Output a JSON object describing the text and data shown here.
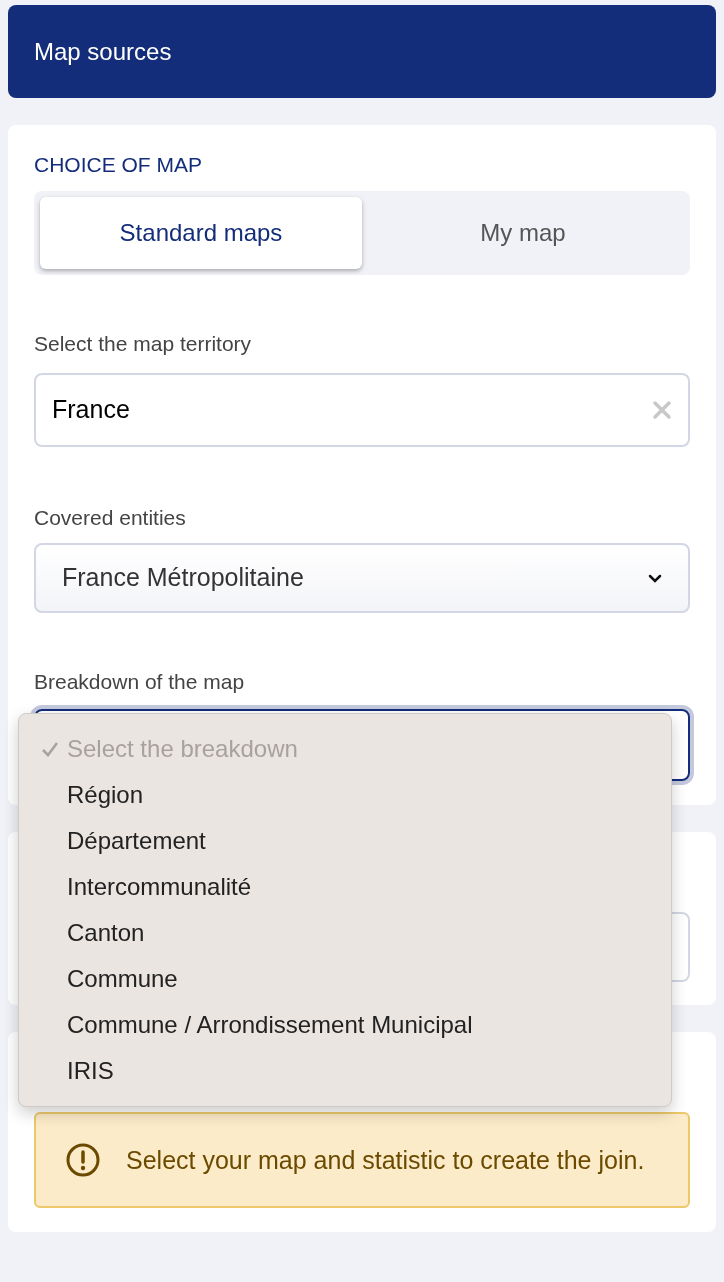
{
  "header": {
    "title": "Map sources"
  },
  "choice": {
    "heading": "CHOICE OF MAP",
    "tabs": [
      {
        "label": "Standard maps",
        "selected": true
      },
      {
        "label": "My map",
        "selected": false
      }
    ]
  },
  "territory": {
    "label": "Select the map territory",
    "value": "France"
  },
  "entities": {
    "label": "Covered entities",
    "value": "France Métropolitaine"
  },
  "breakdown": {
    "label": "Breakdown of the map",
    "expanded": true,
    "options": [
      {
        "label": "Select the breakdown",
        "selected": true,
        "disabled": true
      },
      {
        "label": "Région",
        "selected": false,
        "disabled": false
      },
      {
        "label": "Département",
        "selected": false,
        "disabled": false
      },
      {
        "label": "Intercommunalité",
        "selected": false,
        "disabled": false
      },
      {
        "label": "Canton",
        "selected": false,
        "disabled": false
      },
      {
        "label": "Commune",
        "selected": false,
        "disabled": false
      },
      {
        "label": "Commune / Arrondissement Municipal",
        "selected": false,
        "disabled": false
      },
      {
        "label": "IRIS",
        "selected": false,
        "disabled": false
      }
    ]
  },
  "warning": {
    "text": "Select your map and statistic to create the join."
  }
}
